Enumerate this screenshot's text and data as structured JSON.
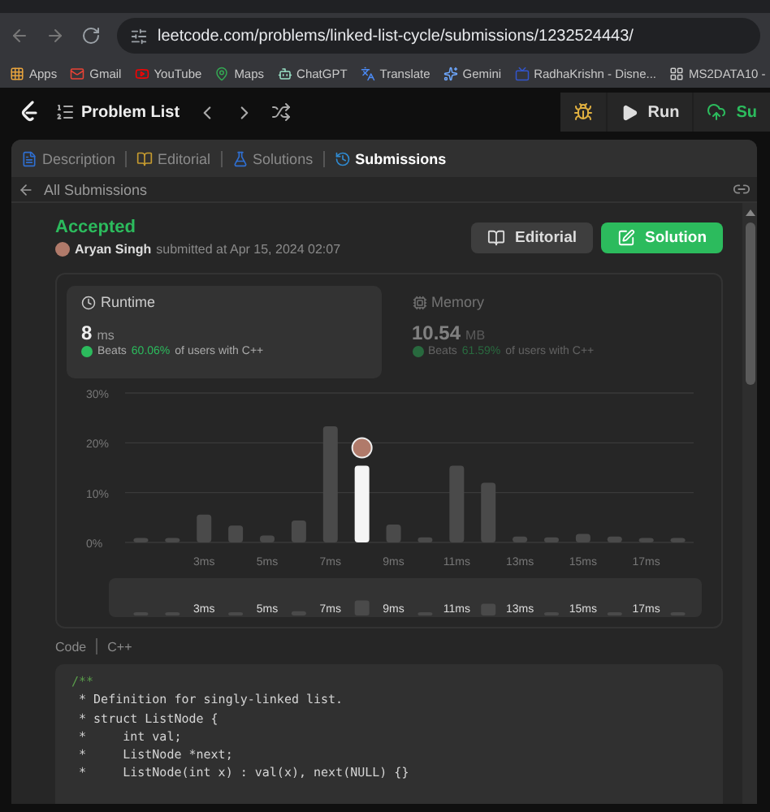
{
  "browser": {
    "url": "leetcode.com/problems/linked-list-cycle/submissions/1232524443/",
    "bookmarks": [
      "Apps",
      "Gmail",
      "YouTube",
      "Maps",
      "ChatGPT",
      "Translate",
      "Gemini",
      "RadhaKrishn - Disne...",
      "MS2DATA10 -"
    ]
  },
  "nav": {
    "problem_list": "Problem List",
    "run": "Run",
    "submit": "Su"
  },
  "tabs": [
    {
      "label": "Description",
      "selected": false
    },
    {
      "label": "Editorial",
      "selected": false
    },
    {
      "label": "Solutions",
      "selected": false
    },
    {
      "label": "Submissions",
      "selected": true
    }
  ],
  "back_link": "All Submissions",
  "submission": {
    "status": "Accepted",
    "author": "Aryan Singh",
    "submitted": "submitted at Apr 15, 2024 02:07",
    "buttons": [
      {
        "label": "Editorial",
        "kind": "secondary"
      },
      {
        "label": "Solution",
        "kind": "primary"
      }
    ]
  },
  "metrics": [
    {
      "label": "Runtime",
      "value": "8",
      "unit": "ms",
      "beats": "Beats",
      "percent": "60.06%",
      "suffix": "of users with C++",
      "selected": true
    },
    {
      "label": "Memory",
      "value": "10.54",
      "unit": "MB",
      "beats": "Beats",
      "percent": "61.59%",
      "suffix": "of users with C++",
      "selected": false
    }
  ],
  "chart_data": {
    "type": "bar",
    "stacked": true,
    "x": [
      1,
      2,
      3,
      4,
      5,
      6,
      7,
      8,
      9,
      10,
      11,
      12,
      13,
      14,
      15,
      16,
      17,
      18
    ],
    "xlim": [
      0.5,
      18.5
    ],
    "series": [
      {
        "color": "#4a4a4a",
        "values": [
          0.9,
          0.9,
          5.6,
          3.4,
          1.4,
          4.4,
          23.3,
          null,
          3.6,
          1.0,
          15.4,
          12.0,
          1.2,
          1.0,
          1.7,
          1.2,
          0.9,
          0.9
        ]
      },
      {
        "color": "#f5f5f5",
        "values": [
          null,
          null,
          null,
          null,
          null,
          null,
          null,
          15.4,
          null,
          null,
          null,
          null,
          null,
          null,
          null,
          null,
          null,
          null
        ]
      }
    ],
    "ylim": [
      0,
      30
    ],
    "yticks": [
      {
        "value": 0,
        "label": "0%"
      },
      {
        "value": 10,
        "label": "10%"
      },
      {
        "value": 20,
        "label": "20%"
      },
      {
        "value": 30,
        "label": "30%"
      }
    ],
    "xticks": [
      {
        "value": 3,
        "label": "3ms"
      },
      {
        "value": 5,
        "label": "5ms"
      },
      {
        "value": 7,
        "label": "7ms"
      },
      {
        "value": 9,
        "label": "9ms"
      },
      {
        "value": 11,
        "label": "11ms"
      },
      {
        "value": 13,
        "label": "13ms"
      },
      {
        "value": 15,
        "label": "15ms"
      },
      {
        "value": 17,
        "label": "17ms"
      }
    ]
  },
  "overview": {
    "labels": [
      "3ms",
      "5ms",
      "7ms",
      "9ms",
      "11ms",
      "13ms",
      "15ms",
      "17ms"
    ]
  },
  "code": {
    "label": "Code",
    "language": "C++",
    "lines": [
      {
        "text": "/**",
        "color": "#5a9e4b"
      },
      {
        "text": " * Definition for singly-linked list.",
        "color": "#d4d4d4"
      },
      {
        "text": " * struct ListNode {",
        "color": "#d4d4d4"
      },
      {
        "text": " *     int val;",
        "color": "#d4d4d4"
      },
      {
        "text": " *     ListNode *next;",
        "color": "#d4d4d4"
      },
      {
        "text": " *     ListNode(int x) : val(x), next(NULL) {}",
        "color": "#d4d4d4"
      }
    ]
  }
}
